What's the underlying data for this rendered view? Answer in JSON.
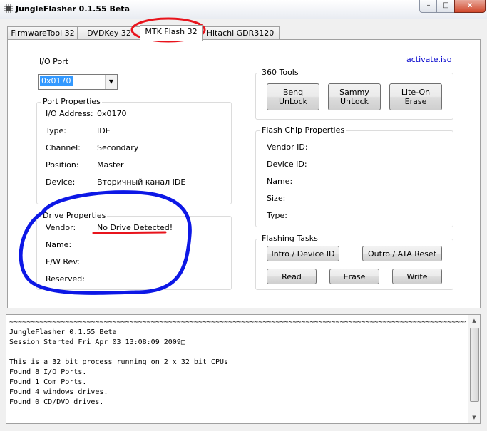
{
  "window": {
    "title": "JungleFlasher 0.1.55 Beta",
    "min_glyph": "–",
    "max_glyph": "□",
    "close_glyph": "x"
  },
  "tabs": [
    "FirmwareTool 32",
    "DVDKey 32",
    "MTK Flash 32",
    "Hitachi GDR3120"
  ],
  "active_tab": "MTK Flash 32",
  "io_port": {
    "label": "I/O Port",
    "value": "0x0170"
  },
  "activate_link": "activate.iso",
  "port_properties": {
    "title": "Port Properties",
    "rows": [
      {
        "label": "I/O Address:",
        "value": "0x0170"
      },
      {
        "label": "Type:",
        "value": "IDE"
      },
      {
        "label": "Channel:",
        "value": "Secondary"
      },
      {
        "label": "Position:",
        "value": "Master"
      },
      {
        "label": "Device:",
        "value": "Вторичный канал IDE"
      }
    ]
  },
  "drive_properties": {
    "title": "Drive Properties",
    "rows": [
      {
        "label": "Vendor:",
        "value": "No Drive Detected!"
      },
      {
        "label": "Name:",
        "value": ""
      },
      {
        "label": "F/W Rev:",
        "value": ""
      },
      {
        "label": "Reserved:",
        "value": ""
      }
    ]
  },
  "tools_360": {
    "title": "360 Tools",
    "buttons": [
      "Benq\nUnLock",
      "Sammy\nUnLock",
      "Lite-On Erase"
    ]
  },
  "flash_chip": {
    "title": "Flash Chip Properties",
    "rows": [
      "Vendor ID:",
      "Device ID:",
      "Name:",
      "Size:",
      "Type:"
    ]
  },
  "flashing_tasks": {
    "title": "Flashing Tasks",
    "buttons": [
      "Intro / Device ID",
      "Outro / ATA Reset",
      "Read",
      "Erase",
      "Write"
    ]
  },
  "log": {
    "text": "~~~~~~~~~~~~~~~~~~~~~~~~~~~~~~~~~~~~~~~~~~~~~~~~~~~~~~~~~~~~~~~~~~~~~~~~~~~~~~~~~~~~~~~~~~~~~~~~~~~~~~~~~~~~~~~~~~~~~\nJungleFlasher 0.1.55 Beta\nSession Started Fri Apr 03 13:08:09 2009□\n\nThis is a 32 bit process running on 2 x 32 bit CPUs\nFound 8 I/O Ports.\nFound 1 Com Ports.\nFound 4 windows drives.\nFound 0 CD/DVD drives."
  },
  "colors": {
    "annotation_red": "#e8141c",
    "annotation_blue": "#0d18e6",
    "link": "#0000cc",
    "selection": "#3399ff"
  }
}
